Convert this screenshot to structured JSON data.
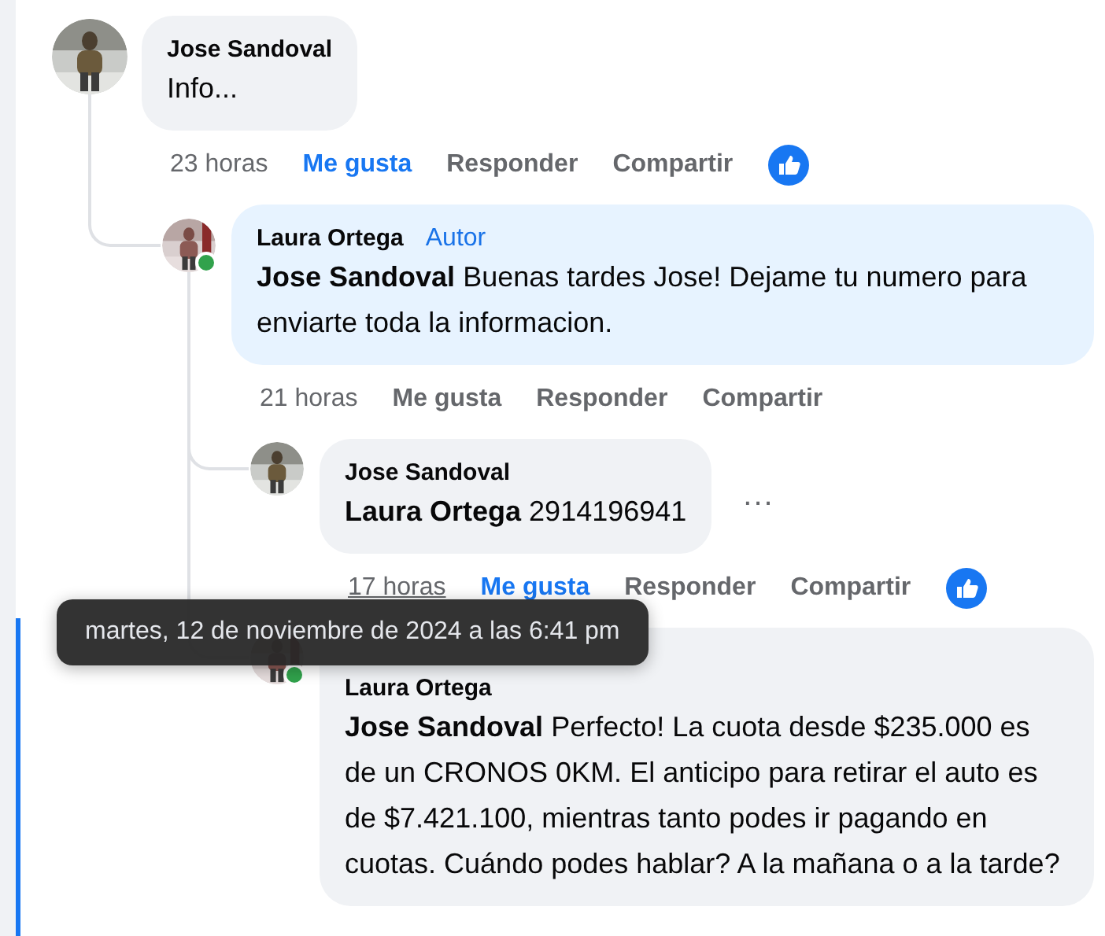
{
  "comments": [
    {
      "author": "Jose Sandoval",
      "online": false,
      "text": "Info...",
      "actions": {
        "time": "23 horas",
        "time_hovered": false,
        "like": "Me gusta",
        "liked": true,
        "reply": "Responder",
        "share": "Compartir",
        "reaction": true
      },
      "children": [
        {
          "author": "Laura Ortega",
          "badge": "Autor",
          "online": true,
          "author_bubble": true,
          "text": "**Jose Sandoval** Buenas tardes Jose! Dejame tu numero para enviarte toda la informacion.",
          "actions": {
            "time": "21 horas",
            "time_hovered": false,
            "like": "Me gusta",
            "liked": false,
            "reply": "Responder",
            "share": "Compartir",
            "reaction": false
          },
          "children": [
            {
              "author": "Jose Sandoval",
              "online": false,
              "text": "**Laura Ortega** 2914196941",
              "more_menu": "...",
              "actions": {
                "time": "17 horas",
                "time_hovered": true,
                "like": "Me gusta",
                "liked": true,
                "reply": "Responder",
                "share": "Compartir",
                "reaction": true
              }
            },
            {
              "author": "Laura Ortega",
              "online": true,
              "focused": true,
              "text": "**Jose Sandoval** Perfecto! La cuota desde $235.000 es de un CRONOS 0KM. El anticipo para retirar el auto es de $7.421.100, mientras tanto podes ir pagando en cuotas. Cuándo podes hablar? A la mañana o a la tarde?"
            }
          ]
        }
      ]
    }
  ],
  "tooltip": {
    "text": "martes, 12 de noviembre de 2024 a las 6:41 pm"
  }
}
